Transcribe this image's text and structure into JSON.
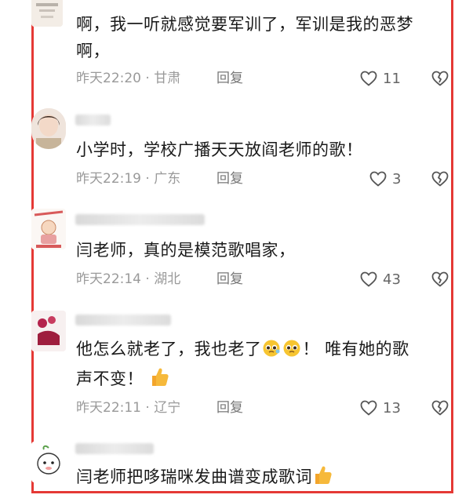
{
  "comments": [
    {
      "text_line1": "啊，我一听就感觉要军训了，军训是我的恶梦",
      "text_line2": "啊，",
      "time": "昨天22:20",
      "location": "甘肃",
      "reply_label": "回复",
      "likes": "11"
    },
    {
      "text_line1": "小学时，学校广播天天放阎老师的歌！",
      "time": "昨天22:19",
      "location": "广东",
      "reply_label": "回复",
      "likes": "3"
    },
    {
      "text_line1": "闫老师，真的是模范歌唱家，",
      "time": "昨天22:14",
      "location": "湖北",
      "reply_label": "回复",
      "likes": "43"
    },
    {
      "text_line1a": "他怎么就老了，我也老了",
      "text_line1b": "！ 唯有她的歌",
      "text_line2": "声不变！",
      "time": "昨天22:11",
      "location": "辽宁",
      "reply_label": "回复",
      "likes": "13"
    },
    {
      "text_line1": "闫老师把哆瑞咪发曲谱变成歌词"
    }
  ],
  "meta_separator": " · ",
  "icons": {
    "like": "heart-outline-icon",
    "dislike": "broken-heart-icon",
    "crying_emoji": "pleading-face-emoji",
    "thumbs_up_emoji": "thumbs-up-emoji"
  },
  "colors": {
    "frame": "#e53935",
    "meta": "#9a9a9a"
  }
}
